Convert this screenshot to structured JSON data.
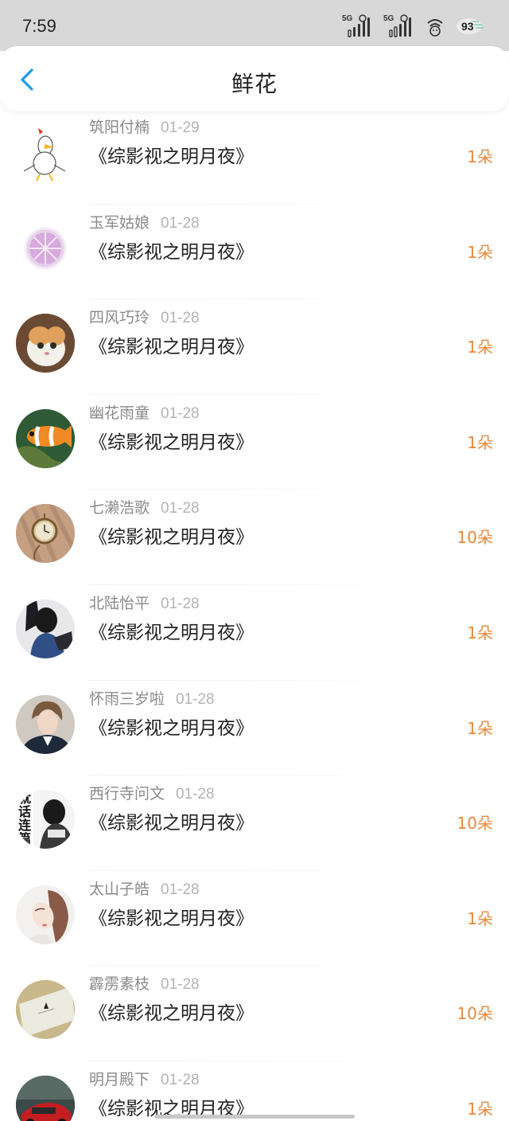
{
  "status_bar": {
    "time": "7:59",
    "signal_1": "5G",
    "signal_2": "5G",
    "battery": "93"
  },
  "nav": {
    "title": "鲜花"
  },
  "items": [
    {
      "user": "筑阳付楠",
      "date": "01-29",
      "book": "《综影视之明月夜》",
      "count": "1朵"
    },
    {
      "user": "玉军姑娘",
      "date": "01-28",
      "book": "《综影视之明月夜》",
      "count": "1朵"
    },
    {
      "user": "四风巧玲",
      "date": "01-28",
      "book": "《综影视之明月夜》",
      "count": "1朵"
    },
    {
      "user": "幽花雨童",
      "date": "01-28",
      "book": "《综影视之明月夜》",
      "count": "1朵"
    },
    {
      "user": "七濑浩歌",
      "date": "01-28",
      "book": "《综影视之明月夜》",
      "count": "10朵"
    },
    {
      "user": "北陆怡平",
      "date": "01-28",
      "book": "《综影视之明月夜》",
      "count": "1朵"
    },
    {
      "user": "怀雨三岁啦",
      "date": "01-28",
      "book": "《综影视之明月夜》",
      "count": "1朵"
    },
    {
      "user": "西行寺问文",
      "date": "01-28",
      "book": "《综影视之明月夜》",
      "count": "10朵"
    },
    {
      "user": "太山子皓",
      "date": "01-28",
      "book": "《综影视之明月夜》",
      "count": "1朵"
    },
    {
      "user": "霹雳素枝",
      "date": "01-28",
      "book": "《综影视之明月夜》",
      "count": "10朵"
    },
    {
      "user": "明月殿下",
      "date": "01-28",
      "book": "《综影视之明月夜》",
      "count": "1朵"
    }
  ],
  "avatar_text": "就话连篇",
  "colors": {
    "accent_blue": "#1a9bea",
    "count_orange": "#e8893a",
    "status_bar_bg": "#d8d8d8"
  }
}
